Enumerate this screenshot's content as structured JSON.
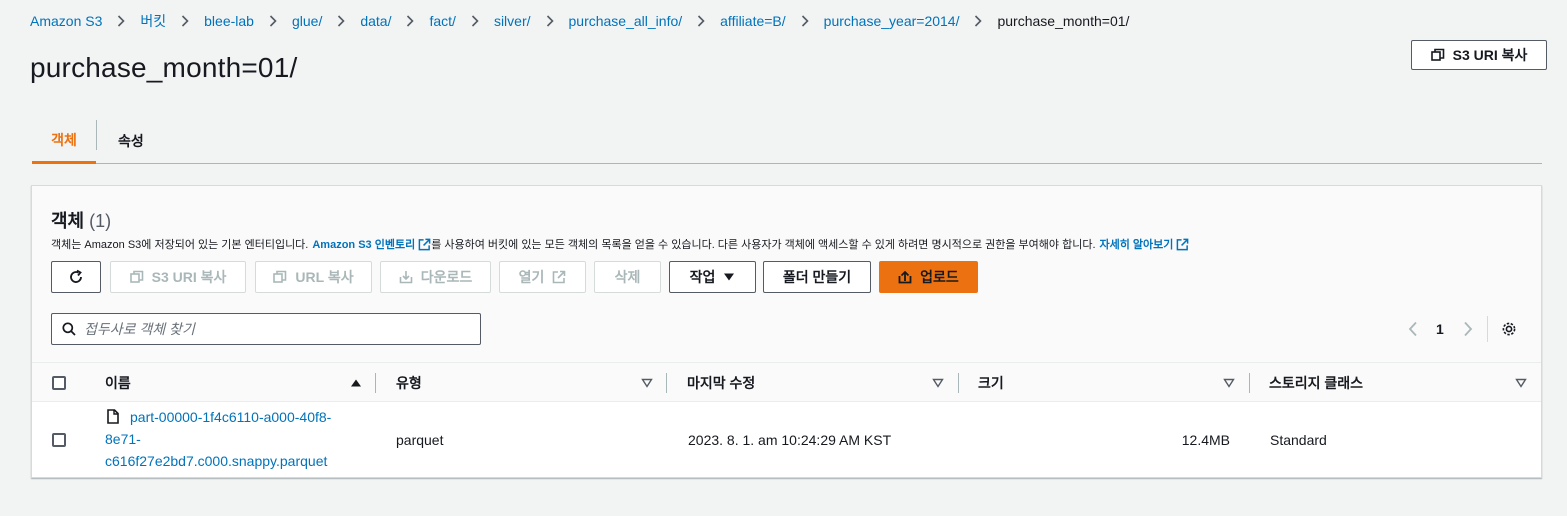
{
  "breadcrumb": [
    "Amazon S3",
    "버킷",
    "blee-lab",
    "glue/",
    "data/",
    "fact/",
    "silver/",
    "purchase_all_info/",
    "affiliate=B/",
    "purchase_year=2014/",
    "purchase_month=01/"
  ],
  "page_title": "purchase_month=01/",
  "copy_uri_button": "S3 URI 복사",
  "tabs": [
    "객체",
    "속성"
  ],
  "panel": {
    "title": "객체",
    "count": "(1)",
    "desc_1": "객체는 Amazon S3에 저장되어 있는 기본 엔터티입니다.",
    "inventory_link": "Amazon S3 인벤토리",
    "desc_2": "를 사용하여 버킷에 있는 모든 객체의 목록을 얻을 수 있습니다. 다른 사용자가 객체에 액세스할 수 있게 하려면 명시적으로 권한을 부여해야 합니다.",
    "learn_more": "자세히 알아보기"
  },
  "toolbar": {
    "copy_s3_uri": "S3 URI 복사",
    "copy_url": "URL 복사",
    "download": "다운로드",
    "open": "열기",
    "delete": "삭제",
    "actions": "작업",
    "create_folder": "폴더 만들기",
    "upload": "업로드"
  },
  "search": {
    "placeholder": "접두사로 객체 찾기"
  },
  "pagination": {
    "current_page": "1"
  },
  "table": {
    "columns": [
      "이름",
      "유형",
      "마지막 수정",
      "크기",
      "스토리지 클래스"
    ],
    "rows": [
      {
        "name_lines": [
          "part-00000-1f4c6110-a000-40f8-",
          "8e71-",
          "c616f27e2bd7.c000.snappy.parquet"
        ],
        "type": "parquet",
        "last_modified": "2023. 8. 1. am 10:24:29 AM KST",
        "size": "12.4MB",
        "storage_class": "Standard"
      }
    ]
  },
  "colors": {
    "link": "#0073bb",
    "accent": "#ec7211",
    "background": "#f2f3f3"
  }
}
